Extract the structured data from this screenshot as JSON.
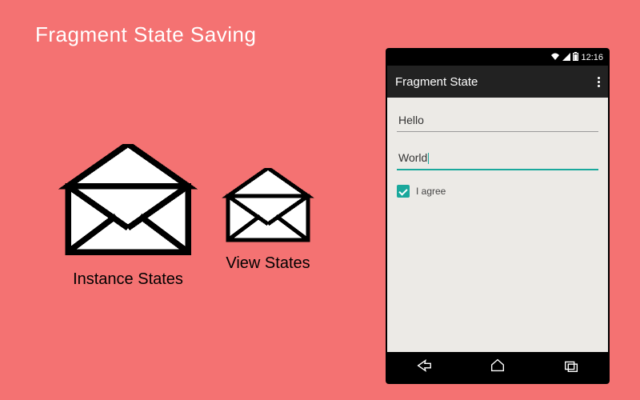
{
  "title": "Fragment State Saving",
  "envelopes": {
    "instance_label": "Instance States",
    "view_label": "View States"
  },
  "phone": {
    "statusbar": {
      "time": "12:16"
    },
    "actionbar": {
      "title": "Fragment State"
    },
    "fields": {
      "input1": "Hello",
      "input2": "World"
    },
    "checkbox": {
      "label": "I agree",
      "checked": true
    },
    "accent_color": "#1aa89c"
  }
}
